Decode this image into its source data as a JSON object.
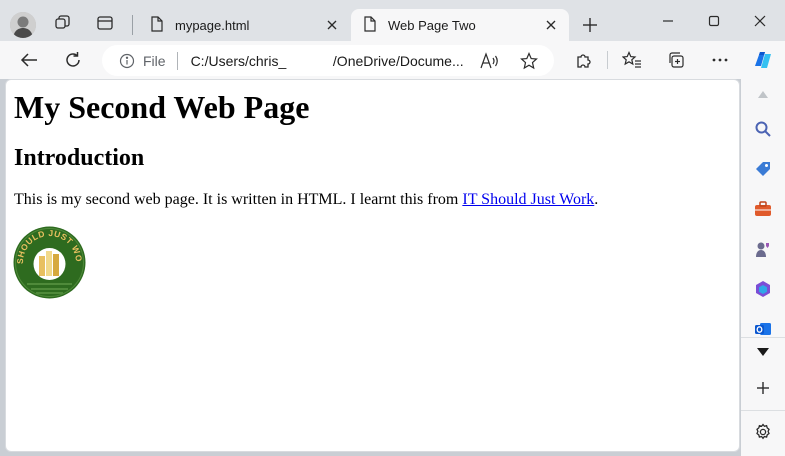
{
  "browser": {
    "tabs": [
      {
        "title": "mypage.html",
        "active": false
      },
      {
        "title": "Web Page Two",
        "active": true
      }
    ],
    "address": {
      "scheme_label": "File",
      "url": "C:/Users/chris_            /OneDrive/Docume..."
    }
  },
  "page": {
    "heading": "My Second Web Page",
    "subheading": "Introduction",
    "paragraph_text": "This is my second web page. It is written in HTML. I learnt this from ",
    "link_text": "IT Should Just Work",
    "paragraph_end": ".",
    "logo_text": "IT SHOULD JUST WORK"
  },
  "colors": {
    "link": "#0000ee",
    "copilot_blue": "#1a73e8",
    "logo_green": "#2e6b1f",
    "logo_gold": "#e8c060"
  },
  "icons": [
    "profile-avatar",
    "workspaces-icon",
    "tab-actions-icon",
    "document-icon",
    "close-icon",
    "new-tab-icon",
    "minimize-icon",
    "maximize-icon",
    "window-close-icon",
    "back-icon",
    "refresh-icon",
    "info-icon",
    "read-aloud-icon",
    "favorite-star-icon",
    "extensions-icon",
    "favorites-icon",
    "collections-icon",
    "more-icon",
    "copilot-icon",
    "search-icon",
    "shopping-tag-icon",
    "tools-icon",
    "games-icon",
    "microsoft365-icon",
    "outlook-icon",
    "sidebar-dropdown-icon",
    "add-icon",
    "settings-gear-icon"
  ]
}
